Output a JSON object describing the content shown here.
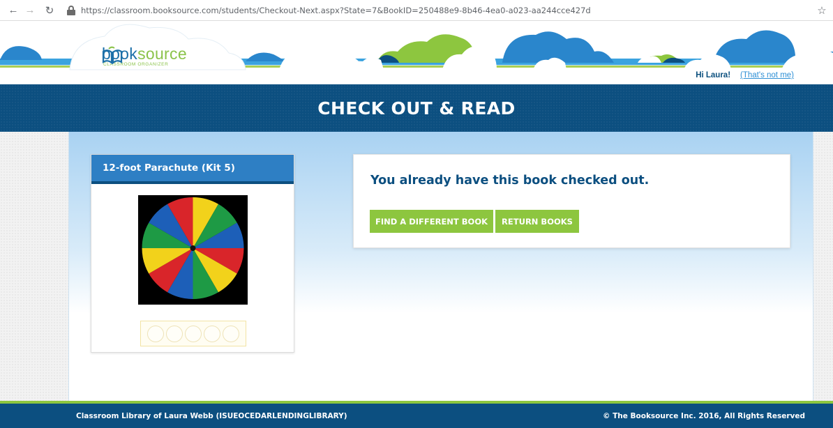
{
  "browser": {
    "url": "https://classroom.booksource.com/students/Checkout-Next.aspx?State=7&BookID=250488e9-8b46-4ea0-a023-aa244cce427d"
  },
  "header": {
    "logo_part1": "book",
    "logo_part2": "source",
    "logo_sub": "CLASSROOM ORGANIZER",
    "greeting": "Hi Laura!",
    "not_me": "(That's not me)"
  },
  "page": {
    "title": "CHECK OUT & READ"
  },
  "book": {
    "title": "12-foot Parachute (Kit 5)",
    "rating_total": 5,
    "rating_value": 0
  },
  "message": {
    "text": "You already have this book checked out.",
    "find_button": "FIND A DIFFERENT BOOK",
    "return_button": "RETURN BOOKS"
  },
  "footer": {
    "library": "Classroom Library of Laura Webb (ISUEOCEDARLENDINGLIBRARY)",
    "copyright": "© The Booksource Inc. 2016, All Rights Reserved"
  },
  "colors": {
    "navy": "#0c4f80",
    "blue": "#2e7fc4",
    "green": "#8dc63f"
  }
}
